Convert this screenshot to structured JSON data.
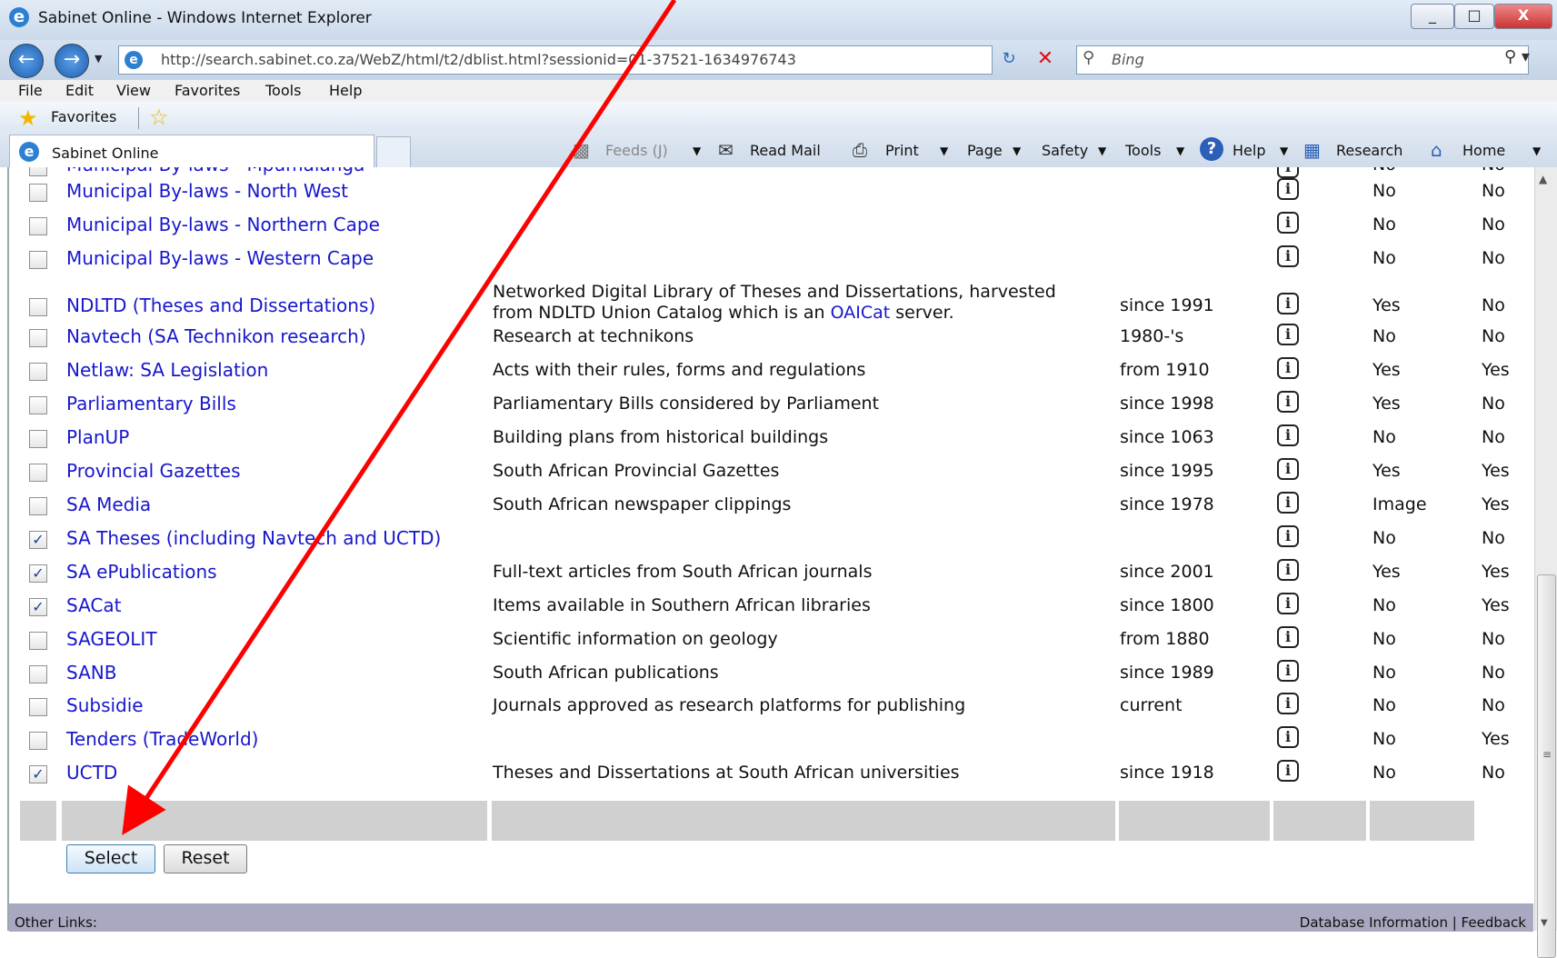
{
  "window": {
    "title": "Sabinet Online  - Windows Internet Explorer",
    "minimize": "_",
    "maximize": "□",
    "close": "X"
  },
  "address": {
    "url": "http://search.sabinet.co.za/WebZ/html/t2/dblist.html?sessionid=01-37521-1634976743",
    "search_placeholder": "Bing"
  },
  "menu": [
    "File",
    "Edit",
    "View",
    "Favorites",
    "Tools",
    "Help"
  ],
  "favorites": {
    "label": "Favorites"
  },
  "tab": {
    "label": "Sabinet Online"
  },
  "commandbar": {
    "feeds": "Feeds (J)",
    "read_mail": "Read Mail",
    "print": "Print",
    "page": "Page",
    "safety": "Safety",
    "tools": "Tools",
    "help": "Help",
    "research": "Research",
    "home": "Home"
  },
  "partial_row": {
    "name": "Municipal By-laws - Mpumalanga",
    "fulltext": "No",
    "image": "No"
  },
  "rows": [
    {
      "name": "Municipal By-laws - North West",
      "desc": "",
      "period": "",
      "fulltext": "No",
      "image": "No",
      "checked": false
    },
    {
      "name": "Municipal By-laws - Northern Cape",
      "desc": "",
      "period": "",
      "fulltext": "No",
      "image": "No",
      "checked": false
    },
    {
      "name": "Municipal By-laws - Western Cape",
      "desc": "",
      "period": "",
      "fulltext": "No",
      "image": "No",
      "checked": false
    },
    {
      "name": "NDLTD (Theses and Dissertations)",
      "desc1": "Networked Digital Library of Theses and Dissertations, harvested",
      "desc2a": "from NDLTD Union Catalog which is an ",
      "desc2link": "OAICat",
      "desc2b": " server.",
      "period": "since 1991",
      "fulltext": "Yes",
      "image": "No",
      "checked": false
    },
    {
      "name": "Navtech (SA Technikon research)",
      "desc": "Research at technikons",
      "period": "1980-'s",
      "fulltext": "No",
      "image": "No",
      "checked": false
    },
    {
      "name": "Netlaw: SA Legislation",
      "desc": "Acts with their rules, forms and regulations",
      "period": "from 1910",
      "fulltext": "Yes",
      "image": "Yes",
      "checked": false
    },
    {
      "name": "Parliamentary Bills",
      "desc": "Parliamentary Bills considered by Parliament",
      "period": "since 1998",
      "fulltext": "Yes",
      "image": "No",
      "checked": false
    },
    {
      "name": "PlanUP",
      "desc": "Building plans from historical buildings",
      "period": "since 1063",
      "fulltext": "No",
      "image": "No",
      "checked": false
    },
    {
      "name": "Provincial Gazettes",
      "desc": "South African Provincial Gazettes",
      "period": "since 1995",
      "fulltext": "Yes",
      "image": "Yes",
      "checked": false
    },
    {
      "name": "SA Media",
      "desc": "South African newspaper clippings",
      "period": "since 1978",
      "fulltext": "Image",
      "image": "Yes",
      "checked": false
    },
    {
      "name": "SA Theses (including Navtech and UCTD)",
      "desc": "",
      "period": "",
      "fulltext": "No",
      "image": "No",
      "checked": true
    },
    {
      "name": "SA ePublications",
      "desc": "Full-text articles from South African journals",
      "period": "since 2001",
      "fulltext": "Yes",
      "image": "Yes",
      "checked": true
    },
    {
      "name": "SACat",
      "desc": "Items available in Southern African libraries",
      "period": "since 1800",
      "fulltext": "No",
      "image": "Yes",
      "checked": true
    },
    {
      "name": "SAGEOLIT",
      "desc": "Scientific information on geology",
      "period": "from 1880",
      "fulltext": "No",
      "image": "No",
      "checked": false
    },
    {
      "name": "SANB",
      "desc": "South African publications",
      "period": "since 1989",
      "fulltext": "No",
      "image": "No",
      "checked": false
    },
    {
      "name": "Subsidie",
      "desc": "Journals approved as research platforms for publishing",
      "period": "current",
      "fulltext": "No",
      "image": "No",
      "checked": false
    },
    {
      "name": "Tenders (TradeWorld)",
      "desc": "",
      "period": "",
      "fulltext": "No",
      "image": "Yes",
      "checked": false
    },
    {
      "name": "UCTD",
      "desc": "Theses and Dissertations at South African universities",
      "period": "since 1918",
      "fulltext": "No",
      "image": "No",
      "checked": true
    }
  ],
  "buttons": {
    "select": "Select",
    "reset": "Reset"
  },
  "footer": {
    "left": "Other Links:",
    "right": "Database Information | Feedback"
  },
  "info_glyph": "i",
  "check_glyph": "✓",
  "colors": {
    "link": "#1717cc",
    "annotation_arrow": "#ff0000",
    "footer_bg": "#a8a8c0"
  }
}
